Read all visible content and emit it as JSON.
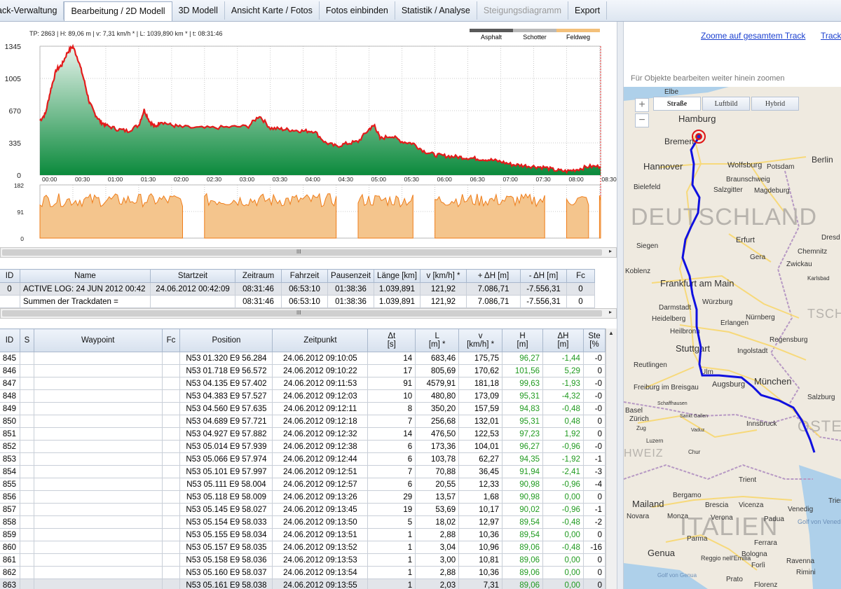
{
  "tabs": [
    {
      "label": "ack-Verwaltung",
      "active": false,
      "disabled": false
    },
    {
      "label": "Bearbeitung / 2D Modell",
      "active": true,
      "disabled": false
    },
    {
      "label": "3D Modell",
      "active": false,
      "disabled": false
    },
    {
      "label": "Ansicht Karte / Fotos",
      "active": false,
      "disabled": false
    },
    {
      "label": "Fotos einbinden",
      "active": false,
      "disabled": false
    },
    {
      "label": "Statistik / Analyse",
      "active": false,
      "disabled": false
    },
    {
      "label": "Steigungsdiagramm",
      "active": false,
      "disabled": true
    },
    {
      "label": "Export",
      "active": false,
      "disabled": false
    }
  ],
  "chart": {
    "info": "TP: 2863 | H: 89,06 m | v: 7,31 km/h * | L: 1039,890 km * | t: 08:31:46",
    "legend": [
      {
        "label": "Asphalt",
        "color": "#5a5a5a"
      },
      {
        "label": "Schotter",
        "color": "#b9b9b9"
      },
      {
        "label": "Feldweg",
        "color": "#f3c07a"
      }
    ],
    "colors": {
      "elevation_line": "#e31b1b",
      "elevation_fill_top": "#e7f3ec",
      "elevation_fill_bottom": "#0b8a3c",
      "speed_fill": "#f4c58d",
      "speed_line": "#ef7d1a"
    }
  },
  "chart_data": [
    {
      "type": "area",
      "ylim": [
        0,
        1345
      ],
      "yticks": [
        "1345",
        "1005",
        "670",
        "335",
        "0"
      ],
      "xticks": [
        "00:00",
        "00:30",
        "01:00",
        "01:30",
        "02:00",
        "02:30",
        "03:00",
        "03:30",
        "04:00",
        "04:30",
        "05:00",
        "05:30",
        "06:00",
        "06:30",
        "07:00",
        "07:30",
        "08:00",
        "08:30"
      ],
      "series": [
        {
          "x_minutes": [
            0,
            5,
            10,
            15,
            20,
            25,
            30,
            35,
            40,
            45,
            50,
            55,
            60,
            70,
            80,
            90,
            95,
            100,
            105,
            110,
            120,
            130,
            150,
            170,
            190,
            200,
            210,
            220,
            230,
            240,
            250,
            260,
            270,
            280,
            290,
            300,
            305,
            310,
            320,
            330,
            340,
            350,
            360,
            370,
            380,
            390,
            400,
            410,
            420,
            430,
            440,
            450,
            460,
            470,
            480,
            490,
            500,
            511
          ],
          "values": [
            570,
            640,
            900,
            1100,
            1150,
            1280,
            1345,
            1200,
            1000,
            760,
            640,
            560,
            520,
            480,
            460,
            520,
            680,
            560,
            500,
            560,
            520,
            500,
            490,
            500,
            510,
            620,
            490,
            480,
            470,
            460,
            460,
            340,
            300,
            330,
            350,
            480,
            520,
            380,
            410,
            350,
            330,
            250,
            210,
            200,
            190,
            180,
            170,
            160,
            140,
            110,
            100,
            90,
            80,
            50,
            40,
            60,
            90,
            89
          ]
        }
      ]
    },
    {
      "type": "area",
      "ylim": [
        0,
        182
      ],
      "yticks": [
        "182",
        "91",
        "0"
      ],
      "series": [
        {
          "segments_minutes": [
            [
              0,
              130
            ],
            [
              150,
              270
            ],
            [
              290,
              340
            ],
            [
              360,
              460
            ],
            [
              480,
              500
            ],
            [
              510,
              511
            ]
          ],
          "level": 130
        }
      ]
    }
  ],
  "track_table": {
    "columns": [
      "ID",
      "Name",
      "Startzeit",
      "Zeitraum",
      "Fahrzeit",
      "Pausenzeit",
      "Länge [km]",
      "v [km/h] *",
      "+ ΔH [m]",
      "- ΔH [m]",
      "Fc"
    ],
    "rows": [
      [
        "0",
        "ACTIVE LOG: 24 JUN 2012 00:42",
        "24.06.2012 00:42:09",
        "08:31:46",
        "06:53:10",
        "01:38:36",
        "1.039,891",
        "121,92",
        "7.086,71",
        "-7.556,31",
        "0"
      ],
      [
        "",
        "Summen der Trackdaten =",
        "",
        "08:31:46",
        "06:53:10",
        "01:38:36",
        "1.039,891",
        "121,92",
        "7.086,71",
        "-7.556,31",
        "0"
      ]
    ],
    "scroll_grip": "III"
  },
  "waypoint_table": {
    "columns": [
      {
        "label": "ID",
        "sub": ""
      },
      {
        "label": "S",
        "sub": ""
      },
      {
        "label": "Waypoint",
        "sub": ""
      },
      {
        "label": "Fc",
        "sub": ""
      },
      {
        "label": "Position",
        "sub": ""
      },
      {
        "label": "Zeitpunkt",
        "sub": ""
      },
      {
        "label": "Δt",
        "sub": "[s]"
      },
      {
        "label": "L",
        "sub": "[m] *"
      },
      {
        "label": "v",
        "sub": "[km/h] *"
      },
      {
        "label": "H",
        "sub": "[m]"
      },
      {
        "label": "ΔH",
        "sub": "[m]"
      },
      {
        "label": "Ste",
        "sub": "[%"
      }
    ],
    "rows": [
      [
        "845",
        "",
        "",
        "",
        "N53 01.320 E9 56.284",
        "24.06.2012 09:10:05",
        "14",
        "683,46",
        "175,75",
        "96,27",
        "-1,44",
        "-0"
      ],
      [
        "846",
        "",
        "",
        "",
        "N53 01.718 E9 56.572",
        "24.06.2012 09:10:22",
        "17",
        "805,69",
        "170,62",
        "101,56",
        "5,29",
        "0"
      ],
      [
        "847",
        "",
        "",
        "",
        "N53 04.135 E9 57.402",
        "24.06.2012 09:11:53",
        "91",
        "4579,91",
        "181,18",
        "99,63",
        "-1,93",
        "-0"
      ],
      [
        "848",
        "",
        "",
        "",
        "N53 04.383 E9 57.527",
        "24.06.2012 09:12:03",
        "10",
        "480,80",
        "173,09",
        "95,31",
        "-4,32",
        "-0"
      ],
      [
        "849",
        "",
        "",
        "",
        "N53 04.560 E9 57.635",
        "24.06.2012 09:12:11",
        "8",
        "350,20",
        "157,59",
        "94,83",
        "-0,48",
        "-0"
      ],
      [
        "850",
        "",
        "",
        "",
        "N53 04.689 E9 57.721",
        "24.06.2012 09:12:18",
        "7",
        "256,68",
        "132,01",
        "95,31",
        "0,48",
        "0"
      ],
      [
        "851",
        "",
        "",
        "",
        "N53 04.927 E9 57.882",
        "24.06.2012 09:12:32",
        "14",
        "476,50",
        "122,53",
        "97,23",
        "1,92",
        "0"
      ],
      [
        "852",
        "",
        "",
        "",
        "N53 05.014 E9 57.939",
        "24.06.2012 09:12:38",
        "6",
        "173,36",
        "104,01",
        "96,27",
        "-0,96",
        "-0"
      ],
      [
        "853",
        "",
        "",
        "",
        "N53 05.066 E9 57.974",
        "24.06.2012 09:12:44",
        "6",
        "103,78",
        "62,27",
        "94,35",
        "-1,92",
        "-1"
      ],
      [
        "854",
        "",
        "",
        "",
        "N53 05.101 E9 57.997",
        "24.06.2012 09:12:51",
        "7",
        "70,88",
        "36,45",
        "91,94",
        "-2,41",
        "-3"
      ],
      [
        "855",
        "",
        "",
        "",
        "N53 05.111 E9 58.004",
        "24.06.2012 09:12:57",
        "6",
        "20,55",
        "12,33",
        "90,98",
        "-0,96",
        "-4"
      ],
      [
        "856",
        "",
        "",
        "",
        "N53 05.118 E9 58.009",
        "24.06.2012 09:13:26",
        "29",
        "13,57",
        "1,68",
        "90,98",
        "0,00",
        "0"
      ],
      [
        "857",
        "",
        "",
        "",
        "N53 05.145 E9 58.027",
        "24.06.2012 09:13:45",
        "19",
        "53,69",
        "10,17",
        "90,02",
        "-0,96",
        "-1"
      ],
      [
        "858",
        "",
        "",
        "",
        "N53 05.154 E9 58.033",
        "24.06.2012 09:13:50",
        "5",
        "18,02",
        "12,97",
        "89,54",
        "-0,48",
        "-2"
      ],
      [
        "859",
        "",
        "",
        "",
        "N53 05.155 E9 58.034",
        "24.06.2012 09:13:51",
        "1",
        "2,88",
        "10,36",
        "89,54",
        "0,00",
        "0"
      ],
      [
        "860",
        "",
        "",
        "",
        "N53 05.157 E9 58.035",
        "24.06.2012 09:13:52",
        "1",
        "3,04",
        "10,96",
        "89,06",
        "-0,48",
        "-16"
      ],
      [
        "861",
        "",
        "",
        "",
        "N53 05.158 E9 58.036",
        "24.06.2012 09:13:53",
        "1",
        "3,00",
        "10,81",
        "89,06",
        "0,00",
        "0"
      ],
      [
        "862",
        "",
        "",
        "",
        "N53 05.160 E9 58.037",
        "24.06.2012 09:13:54",
        "1",
        "2,88",
        "10,36",
        "89,06",
        "0,00",
        "0"
      ],
      [
        "863",
        "",
        "",
        "",
        "N53 05.161 E9 58.038",
        "24.06.2012 09:13:55",
        "1",
        "2,03",
        "7,31",
        "89,06",
        "0,00",
        "0"
      ]
    ]
  },
  "map": {
    "zoom_link": "Zoome auf gesamtem Track",
    "track_link": "Track",
    "hint": "Für Objekte bearbeiten weiter hinein zoomen",
    "types": [
      "Straße",
      "Luftbild",
      "Hybrid"
    ],
    "country_labels": [
      "DEUTSCHLAND",
      "TSCHE",
      "OSTE",
      "HWEIZ",
      "ITALIEN"
    ],
    "cities": [
      "Elbe",
      "Hamburg",
      "Bremen",
      "Hannover",
      "Wolfsburg",
      "Potsdam",
      "Berlin",
      "Braunschweig",
      "Bielefeld",
      "Salzgitter",
      "Magdeburg",
      "Siegen",
      "Erfurt",
      "Chemnitz",
      "Dresd",
      "Gera",
      "Zwickau",
      "Koblenz",
      "Frankfurt am Main",
      "Karlsbad",
      "Würzburg",
      "Darmstadt",
      "Heidelberg",
      "Erlangen",
      "Nürnberg",
      "Heilbronn",
      "Regensburg",
      "Stuttgart",
      "Ingolstadt",
      "Reutlingen",
      "Ulm",
      "Augsburg",
      "München",
      "Freiburg im Breisgau",
      "Salzburg",
      "Basel",
      "Zürich",
      "Innsbruck",
      "Zug",
      "Luzern",
      "Chur",
      "Trient",
      "Bergamo",
      "Mailand",
      "Brescia",
      "Vicenza",
      "Venedig",
      "Novara",
      "Monza",
      "Verona",
      "Padua",
      "Parma",
      "Ferrara",
      "Genua",
      "Reggio nell'Emilia",
      "Bologna",
      "Ravenna",
      "Forlì",
      "Rimini",
      "Prato",
      "Florenz",
      "Triest",
      "Golf von Venedig",
      "Golf von Genua",
      "Vaduz",
      "Sankt Gallen",
      "Schaffhausen",
      "Siegen"
    ],
    "colors": {
      "track": "#1010e0",
      "marker": "#e01515",
      "land": "#efeae0",
      "road": "#f7d97a"
    }
  }
}
